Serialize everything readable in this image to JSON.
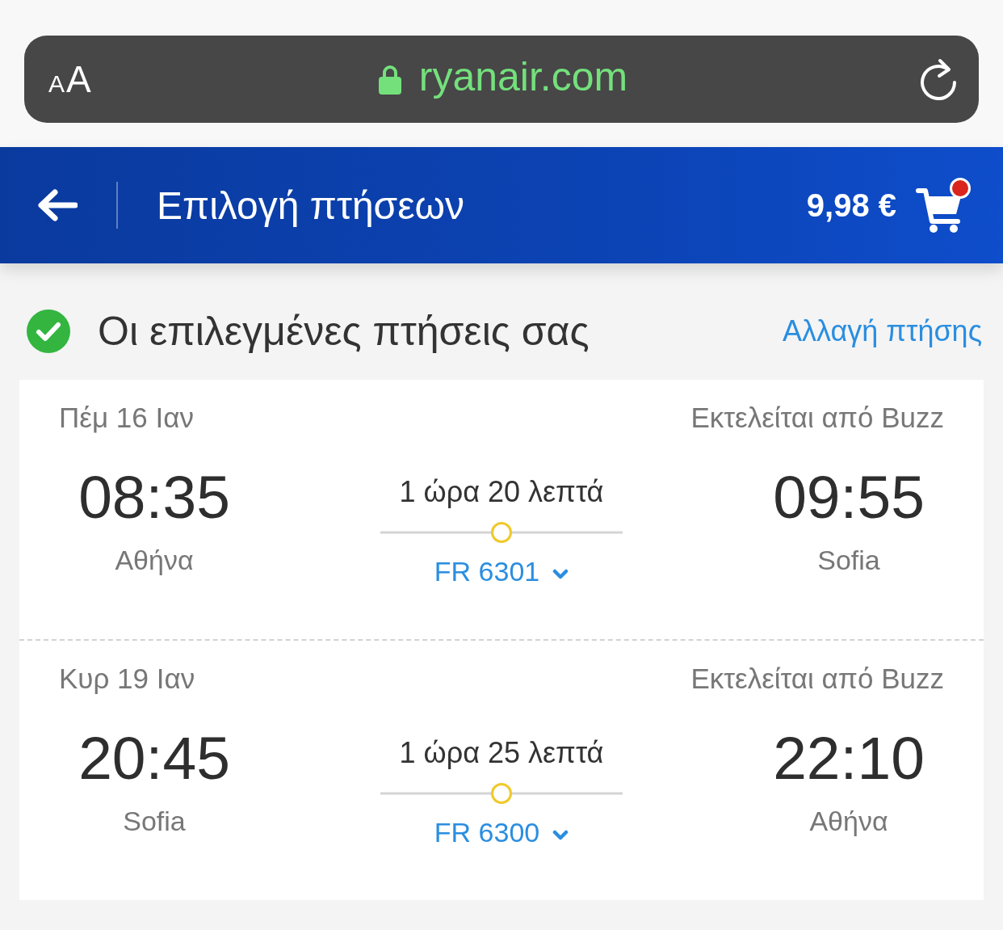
{
  "browser_bar": {
    "text_size_label": "AA",
    "url": "ryanair.com"
  },
  "header": {
    "title": "Επιλογή πτήσεων",
    "cart": {
      "total": "9,98 €",
      "badge": true
    }
  },
  "selection": {
    "title": "Οι επιλεγμένες πτήσεις σας",
    "change_link": "Αλλαγή πτήσης"
  },
  "flights": [
    {
      "date": "Πέμ 16 Ιαν",
      "operator": "Εκτελείται από Buzz",
      "departure_time": "08:35",
      "departure_city": "Αθήνα",
      "duration": "1 ώρα 20 λεπτά",
      "flight_number": "FR 6301",
      "expanded": false,
      "arrival_time": "09:55",
      "arrival_city": "Sofia"
    },
    {
      "date": "Κυρ 19 Ιαν",
      "operator": "Εκτελείται από Buzz",
      "departure_time": "20:45",
      "departure_city": "Sofia",
      "duration": "1 ώρα 25 λεπτά",
      "flight_number": "FR 6300",
      "expanded": false,
      "arrival_time": "22:10",
      "arrival_city": "Αθήνα"
    }
  ]
}
